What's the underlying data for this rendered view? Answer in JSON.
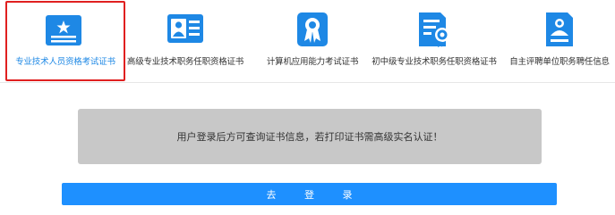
{
  "tabs": [
    {
      "label": "专业技术人员资格考试证书",
      "icon": "certificate-star-icon",
      "active": true
    },
    {
      "label": "高级专业技术职务任职资格证书",
      "icon": "id-card-icon",
      "active": false
    },
    {
      "label": "计算机应用能力考试证书",
      "icon": "award-badge-icon",
      "active": false
    },
    {
      "label": "初中级专业技术职务任职资格证书",
      "icon": "document-seal-icon",
      "active": false
    },
    {
      "label": "自主评聘单位职务聘任信息",
      "icon": "user-document-icon",
      "active": false
    }
  ],
  "notice": {
    "text": "用户登录后方可查询证书信息，若打印证书需高级实名认证！"
  },
  "login_button": {
    "label": "去 登 录"
  },
  "colors": {
    "icon_blue": "#1e88e5",
    "active_border": "#e02020",
    "button_blue": "#1e90ff",
    "notice_bg": "#c8c8c8"
  }
}
